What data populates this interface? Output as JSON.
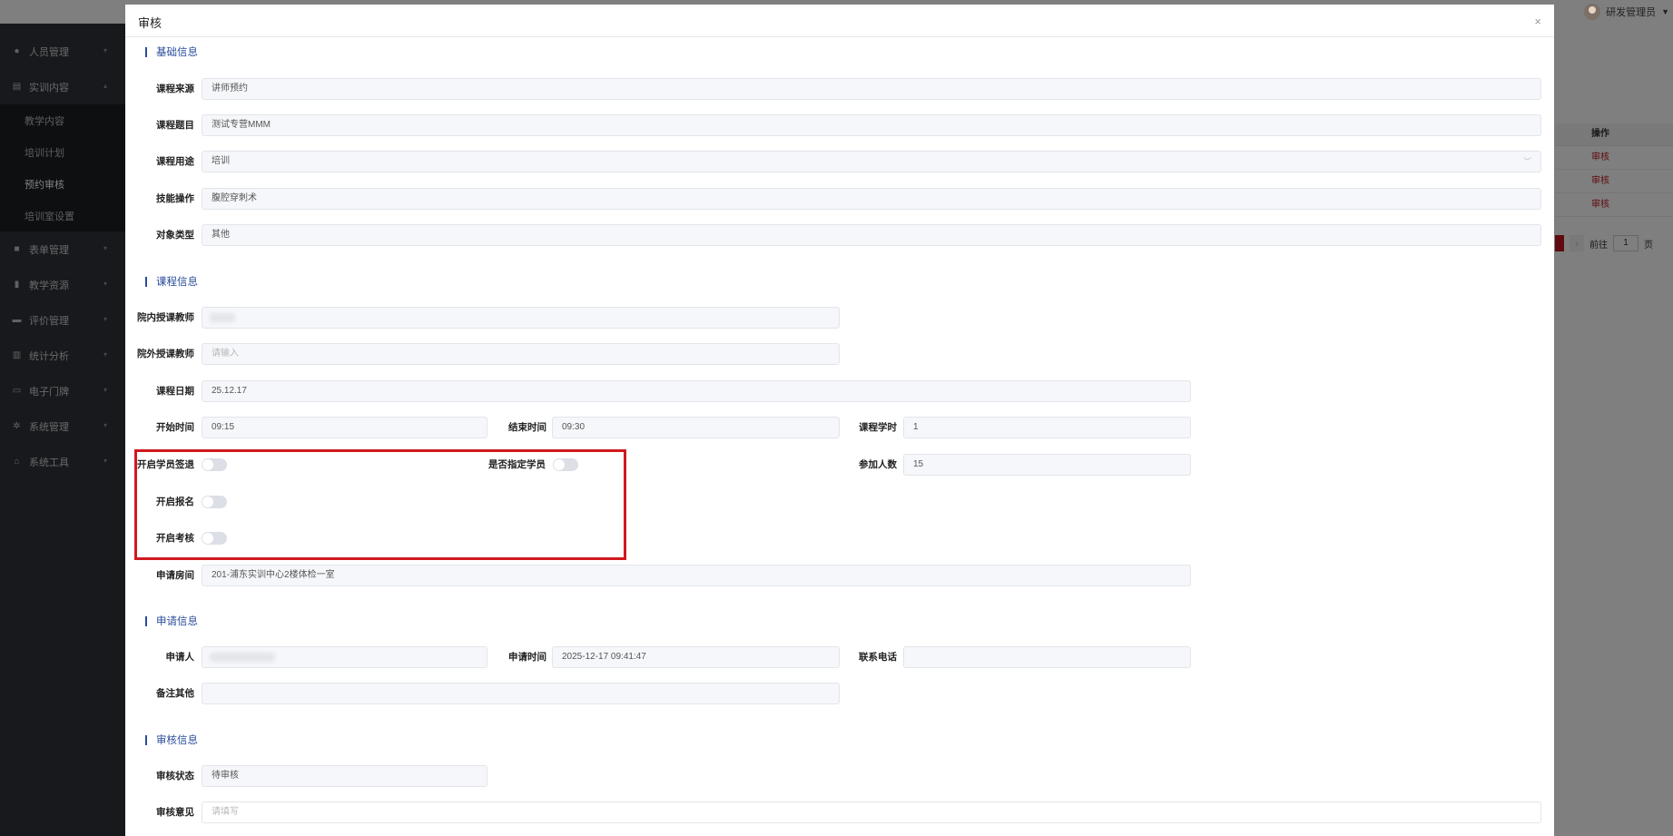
{
  "header": {
    "user_name": "研发管理员"
  },
  "sidebar": {
    "items": [
      {
        "label": "人员管理",
        "icon": "person-icon"
      },
      {
        "label": "实训内容",
        "icon": "content-icon"
      },
      {
        "label": "表单管理",
        "icon": "form-icon"
      },
      {
        "label": "教学资源",
        "icon": "resource-icon"
      },
      {
        "label": "评价管理",
        "icon": "evaluation-icon"
      },
      {
        "label": "统计分析",
        "icon": "bar-chart-icon"
      },
      {
        "label": "电子门牌",
        "icon": "doorplate-icon"
      },
      {
        "label": "系统管理",
        "icon": "gear-icon"
      },
      {
        "label": "系统工具",
        "icon": "tools-icon"
      }
    ],
    "sub_items": [
      {
        "label": "教学内容"
      },
      {
        "label": "培训计划"
      },
      {
        "label": "预约审核"
      },
      {
        "label": "培训室设置"
      }
    ]
  },
  "background_table": {
    "header": "操作",
    "rows": [
      "审核",
      "审核",
      "审核"
    ],
    "pager": {
      "goto_label": "前往",
      "page": "1",
      "page_suffix": "页"
    }
  },
  "modal": {
    "title": "审核",
    "close_symbol": "×",
    "sections": {
      "basic": "基础信息",
      "course": "课程信息",
      "apply": "申请信息",
      "review": "审核信息"
    },
    "basic": {
      "source": {
        "label": "课程来源",
        "value": "讲师预约"
      },
      "topic": {
        "label": "课程题目",
        "value": "测试专营MMM"
      },
      "purpose": {
        "label": "课程用途",
        "value": "培训"
      },
      "skill": {
        "label": "技能操作",
        "value": "腹腔穿刺术"
      },
      "target": {
        "label": "对象类型",
        "value": "其他"
      }
    },
    "course": {
      "inner_teacher": {
        "label": "院内授课教师",
        "value": ""
      },
      "outer_teacher": {
        "label": "院外授课教师",
        "placeholder": "请输入"
      },
      "date": {
        "label": "课程日期",
        "value": "25.12.17"
      },
      "start": {
        "label": "开始时间",
        "value": "09:15"
      },
      "end": {
        "label": "结束时间",
        "value": "09:30"
      },
      "hours": {
        "label": "课程学时",
        "value": "1"
      },
      "sign_out": {
        "label": "开启学员签退",
        "on": false
      },
      "designate": {
        "label": "是否指定学员",
        "on": false
      },
      "count": {
        "label": "参加人数",
        "value": "15"
      },
      "enroll": {
        "label": "开启报名",
        "on": false
      },
      "exam": {
        "label": "开启考核",
        "on": false
      },
      "room": {
        "label": "申请房间",
        "value": "201-浦东实训中心2楼体检一室"
      }
    },
    "apply": {
      "applicant": {
        "label": "申请人",
        "value": ""
      },
      "time": {
        "label": "申请时间",
        "value": "2025-12-17 09:41:47"
      },
      "phone": {
        "label": "联系电话",
        "value": ""
      },
      "remark": {
        "label": "备注其他",
        "value": ""
      }
    },
    "review": {
      "status": {
        "label": "审核状态",
        "value": "待审核"
      },
      "opinion": {
        "label": "审核意见",
        "placeholder": "请填写"
      }
    }
  },
  "colors": {
    "accent": "#2a4c9a",
    "highlight": "#d0191f",
    "danger": "#c0151e"
  }
}
